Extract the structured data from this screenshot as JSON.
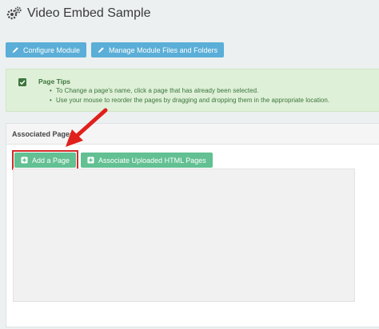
{
  "page": {
    "title": "Video Embed Sample"
  },
  "toolbar": {
    "configure_label": "Configure Module",
    "manage_label": "Manage Module Files and Folders"
  },
  "tips": {
    "title": "Page Tips",
    "items": [
      "To Change a page's name, click a page that has already been selected.",
      "Use your mouse to reorder the pages by dragging and dropping them in the appropriate location."
    ]
  },
  "associated": {
    "heading": "Associated Pages",
    "add_label": "Add a Page",
    "associate_label": "Associate Uploaded HTML Pages"
  },
  "colors": {
    "accent_blue": "#5aaed7",
    "accent_green": "#62c092",
    "highlight_red": "#d42b2b"
  }
}
